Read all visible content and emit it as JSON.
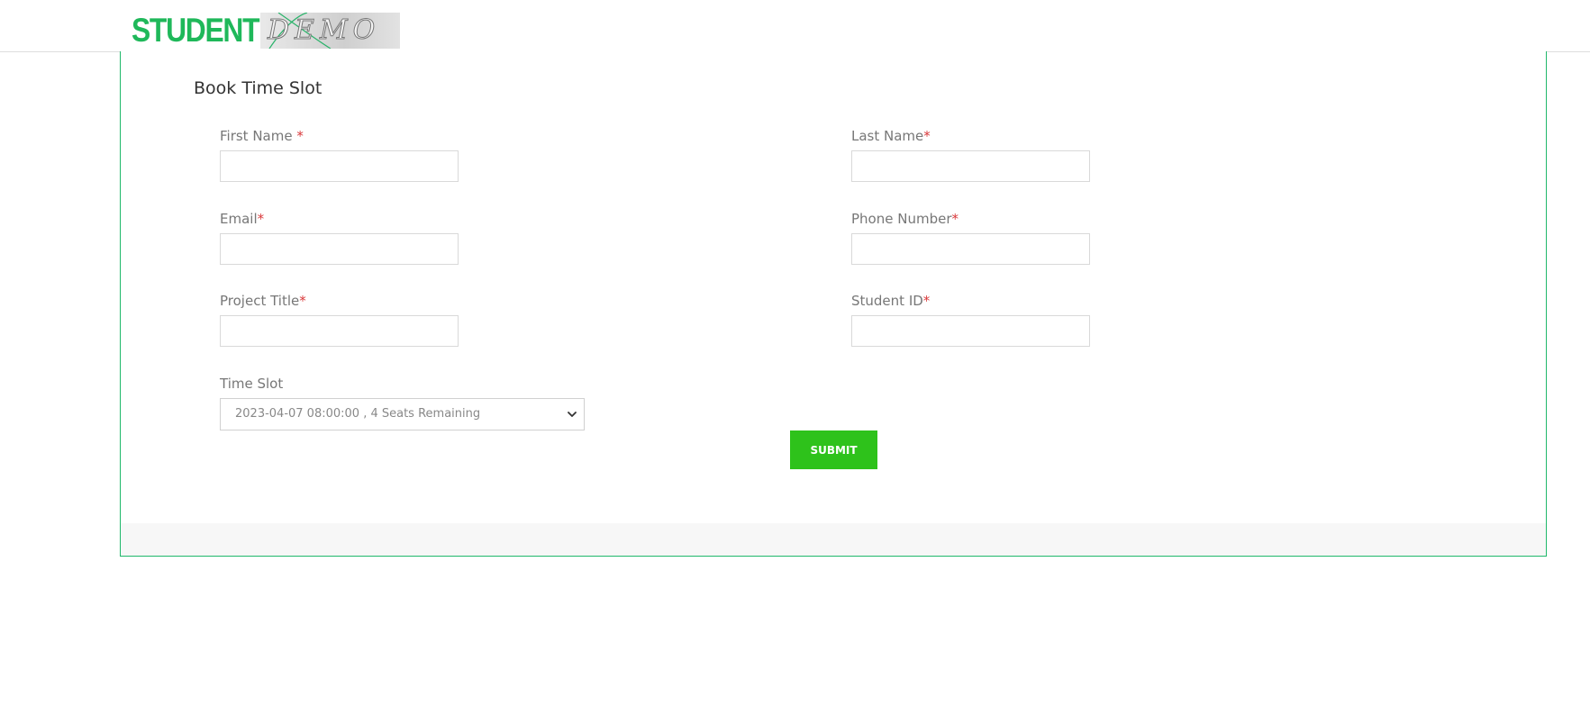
{
  "header": {
    "logo": {
      "part1": "STUDENT",
      "part2": "DEMO"
    }
  },
  "form": {
    "title": "Book Time Slot",
    "fields": {
      "first_name": {
        "label": "First Name ",
        "required_mark": "*",
        "value": ""
      },
      "last_name": {
        "label": "Last Name",
        "required_mark": "*",
        "value": ""
      },
      "email": {
        "label": "Email",
        "required_mark": "*",
        "value": ""
      },
      "phone_number": {
        "label": "Phone Number",
        "required_mark": "*",
        "value": ""
      },
      "project_title": {
        "label": "Project Title",
        "required_mark": "*",
        "value": ""
      },
      "student_id": {
        "label": "Student ID",
        "required_mark": "*",
        "value": ""
      }
    },
    "time_slot": {
      "label": "Time Slot",
      "selected": "2023-04-07 08:00:00 , 4 Seats Remaining"
    },
    "submit_label": "SUBMIT"
  },
  "colors": {
    "accent_green": "#2ec21b",
    "border_green": "#1fb86a",
    "logo_green": "#1fb85a",
    "required_red": "#d9383a"
  },
  "icons": {
    "select_arrow": "chevron-down-icon"
  }
}
